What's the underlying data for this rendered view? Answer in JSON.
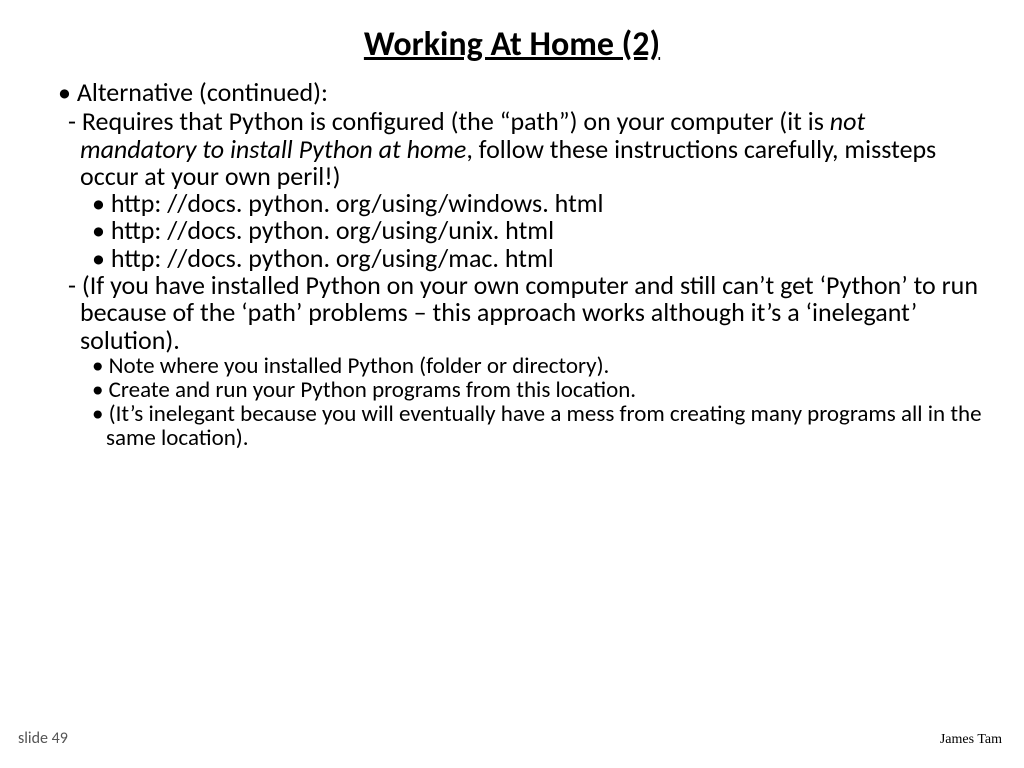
{
  "title": "Working At Home (2)",
  "bullet1": "Alternative (continued):",
  "req_a": "Requires that Python is configured (the “path”) on your computer (it is ",
  "req_italic": " not mandatory to install Python at home",
  "req_b": ", follow these instructions carefully, missteps occur at your own peril!)",
  "link1": "http: //docs. python. org/using/windows. html",
  "link2": "http: //docs. python. org/using/unix. html",
  "link3": "http: //docs. python. org/using/mac. html",
  "para2": "(If you have installed Python on your own computer and still can’t get ‘Python’ to run because of the ‘path’ problems – this approach works although it’s a ‘inelegant’ solution).",
  "note1": "Note where you installed Python (folder or directory).",
  "note2": "Create and run your Python programs from this location.",
  "note3": "(It’s inelegant because you will eventually have a mess from creating many programs all in the same location).",
  "footer_left": "slide 49",
  "footer_right": "James Tam"
}
